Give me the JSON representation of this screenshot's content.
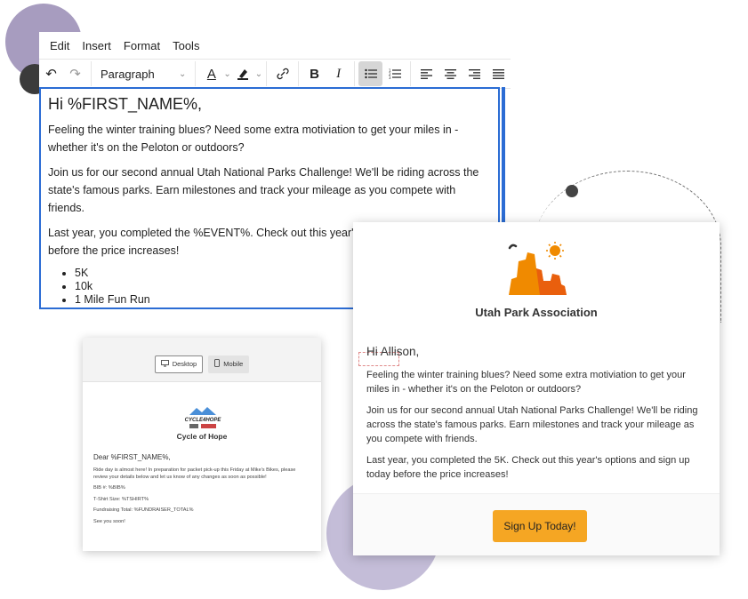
{
  "editor": {
    "menu": [
      "Edit",
      "Insert",
      "Format",
      "Tools"
    ],
    "block_format": "Paragraph",
    "heading": "Hi %FIRST_NAME%,",
    "paragraphs": [
      "Feeling the winter training blues? Need some extra motiviation to get your miles in - whether it's on the Peloton or outdoors?",
      "Join us for our second annual Utah National Parks Challenge! We'll be riding across the state's famous parks. Earn milestones and track your mileage as you compete with friends.",
      "Last year, you completed the %EVENT%. Check out this year's options and sign up today before the price increases!"
    ],
    "list": [
      "5K",
      "10k",
      "1 Mile Fun Run"
    ]
  },
  "email_card": {
    "org_name": "Utah Park Association",
    "greeting": "Hi Allison,",
    "paragraphs": [
      "Feeling the winter training blues? Need some extra motiviation to get your miles in - whether it's on the Peloton or outdoors?",
      "Join us for our second annual Utah National Parks Challenge! We'll be riding across the state's famous parks. Earn milestones and track your mileage as you compete with friends.",
      "Last year, you completed the 5K. Check out this year's options and sign up today before the price increases!"
    ],
    "cta_label": "Sign Up Today!",
    "colors": {
      "cta": "#f5a623",
      "logo_orange": "#f08a00"
    }
  },
  "preview": {
    "desktop_label": "Desktop",
    "mobile_label": "Mobile",
    "logo_text": "CYCLE4HOPE",
    "org_name": "Cycle of Hope",
    "greeting": "Dear %FIRST_NAME%,",
    "lines": [
      "Ride day is almost here! In preparation for packet pick-up this Friday at Mike's Bikes, please review your details below and let us know of any changes as soon as possible!",
      "BIB #: %BIB%",
      "T-Shirt Size: %TSHIRT%",
      "Fundraising Total: %FUNDRAISER_TOTAL%",
      "See you soon!"
    ]
  }
}
